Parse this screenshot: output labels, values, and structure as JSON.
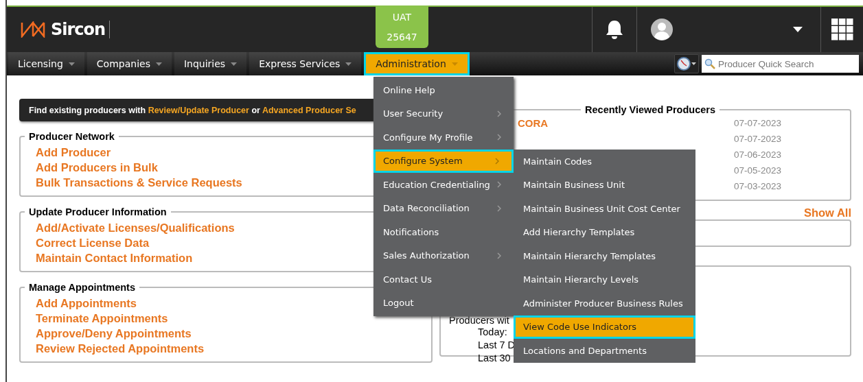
{
  "header": {
    "logo": "Sircon",
    "environment": {
      "name": "UAT",
      "build": "25647"
    }
  },
  "nav": {
    "tabs": [
      {
        "label": "Licensing",
        "selected": false
      },
      {
        "label": "Companies",
        "selected": false
      },
      {
        "label": "Inquiries",
        "selected": false
      },
      {
        "label": "Express Services",
        "selected": false
      },
      {
        "label": "Administration",
        "selected": true
      }
    ],
    "search": {
      "placeholder": "Producer Quick Search"
    }
  },
  "banner": [
    {
      "kind": "plain",
      "text": "Find existing producers with "
    },
    {
      "kind": "link",
      "text": "Review/Update Producer"
    },
    {
      "kind": "plain",
      "text": " or "
    },
    {
      "kind": "link",
      "text": "Advanced Producer Se"
    }
  ],
  "sections": [
    {
      "title": "Producer Network",
      "links": [
        "Add Producer",
        "Add Producers in Bulk",
        "Bulk Transactions & Service Requests"
      ]
    },
    {
      "title": "Update Producer Information",
      "links": [
        "Add/Activate Licenses/Qualifications",
        "Correct License Data",
        "Maintain Contact Information"
      ]
    },
    {
      "title": "Manage Appointments",
      "links": [
        "Add Appointments",
        "Terminate Appointments",
        "Approve/Deny Appointments",
        "Review Rejected Appointments"
      ]
    }
  ],
  "recent": {
    "title": "Recently Viewed Producers",
    "rows": [
      {
        "name": "CORA",
        "date": "07-07-2023"
      },
      {
        "date": "07-07-2023"
      },
      {
        "date": "07-06-2023"
      },
      {
        "date": "07-05-2023"
      },
      {
        "date": "07-03-2023"
      }
    ],
    "show_all": "Show All"
  },
  "stats": {
    "heading": "Producers wit",
    "rows": [
      "Today:",
      "Last 7 D",
      "Last 30"
    ]
  },
  "menu": {
    "items": [
      {
        "label": "Online Help",
        "submenu": false,
        "selected": false
      },
      {
        "label": "User Security",
        "submenu": true,
        "selected": false
      },
      {
        "label": "Configure My Profile",
        "submenu": true,
        "selected": false
      },
      {
        "label": "Configure System",
        "submenu": true,
        "selected": true
      },
      {
        "label": "Education Credentialing",
        "submenu": true,
        "selected": false
      },
      {
        "label": "Data Reconciliation",
        "submenu": true,
        "selected": false
      },
      {
        "label": "Notifications",
        "submenu": false,
        "selected": false
      },
      {
        "label": "Sales Authorization",
        "submenu": true,
        "selected": false
      },
      {
        "label": "Contact Us",
        "submenu": false,
        "selected": false
      },
      {
        "label": "Logout",
        "submenu": false,
        "selected": false
      }
    ]
  },
  "submenu": {
    "items": [
      {
        "label": "Maintain Codes",
        "selected": false
      },
      {
        "label": "Maintain Business Unit",
        "selected": false
      },
      {
        "label": "Maintain Business Unit Cost Center",
        "selected": false
      },
      {
        "label": "Add Hierarchy Templates",
        "selected": false
      },
      {
        "label": "Maintain Hierarchy Templates",
        "selected": false
      },
      {
        "label": "Maintain Hierarchy Levels",
        "selected": false
      },
      {
        "label": "Administer Producer Business Rules",
        "selected": false
      },
      {
        "label": "View Code Use Indicators",
        "selected": true
      },
      {
        "label": "Locations and Departments",
        "selected": false
      }
    ]
  }
}
